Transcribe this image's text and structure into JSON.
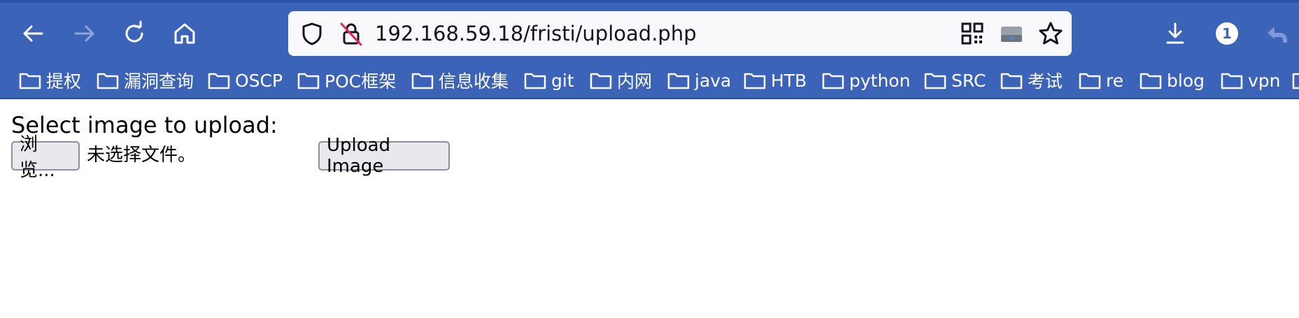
{
  "browser": {
    "url": "192.168.59.18/fristi/upload.php",
    "notification_count": "1",
    "nav_icons": [
      "back-arrow-icon",
      "forward-arrow-icon",
      "reload-icon",
      "home-icon"
    ],
    "url_icons": [
      "shield-icon",
      "insecure-lock-icon",
      "qr-code-icon",
      "drive-icon",
      "star-icon"
    ],
    "right_icons": [
      "download-icon",
      "notification-badge",
      "undo-icon"
    ]
  },
  "bookmarks": [
    {
      "label": "提权"
    },
    {
      "label": "漏洞查询"
    },
    {
      "label": "OSCP"
    },
    {
      "label": "POC框架"
    },
    {
      "label": "信息收集"
    },
    {
      "label": "git"
    },
    {
      "label": "内网"
    },
    {
      "label": "java"
    },
    {
      "label": "HTB"
    },
    {
      "label": "python"
    },
    {
      "label": "SRC"
    },
    {
      "label": "考试"
    },
    {
      "label": "re"
    },
    {
      "label": "blog"
    },
    {
      "label": "vpn"
    }
  ],
  "page": {
    "title": "Select image to upload:",
    "browse_label": "浏览...",
    "no_file_text": "未选择文件。",
    "upload_label": "Upload Image"
  },
  "colors": {
    "toolbar": "#3b63b8",
    "urlbar": "#f9f9fb",
    "button_bg": "#e9e9ed",
    "button_border": "#8f8f9d"
  }
}
